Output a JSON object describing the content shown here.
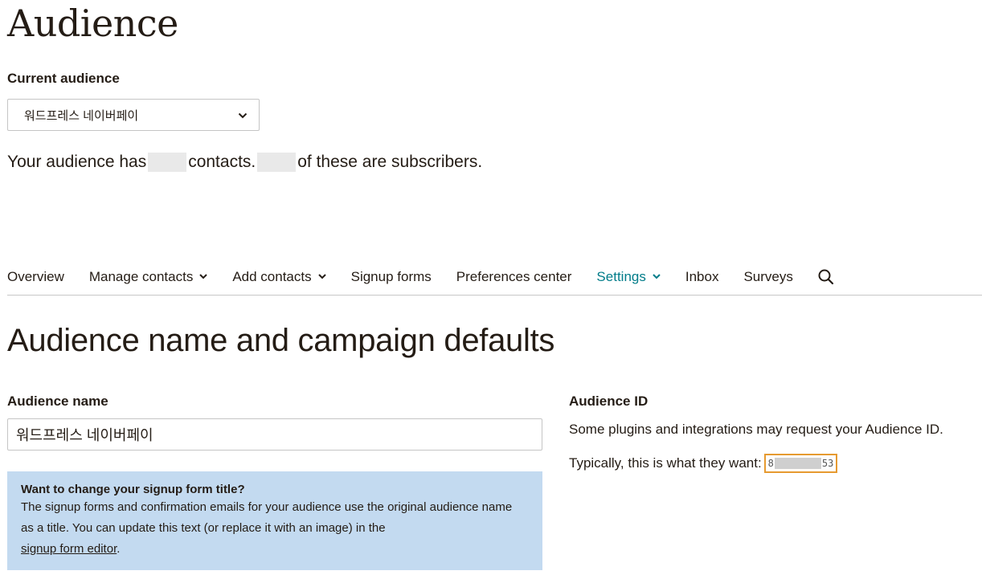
{
  "header": {
    "title": "Audience"
  },
  "current_audience": {
    "label": "Current audience",
    "selected": "워드프레스 네이버페이",
    "dropdown_icon": "chevron-down-icon"
  },
  "summary": {
    "prefix": "Your audience has",
    "middle": "contacts.",
    "suffix": "of these are subscribers."
  },
  "nav": {
    "items": [
      {
        "label": "Overview",
        "dropdown": false,
        "active": false
      },
      {
        "label": "Manage contacts",
        "dropdown": true,
        "active": false
      },
      {
        "label": "Add contacts",
        "dropdown": true,
        "active": false
      },
      {
        "label": "Signup forms",
        "dropdown": false,
        "active": false
      },
      {
        "label": "Preferences center",
        "dropdown": false,
        "active": false
      },
      {
        "label": "Settings",
        "dropdown": true,
        "active": true
      },
      {
        "label": "Inbox",
        "dropdown": false,
        "active": false
      },
      {
        "label": "Surveys",
        "dropdown": false,
        "active": false
      }
    ],
    "search_icon": "search-icon",
    "active_color": "#007c89"
  },
  "section": {
    "title": "Audience name and campaign defaults",
    "audience_name_label": "Audience name",
    "audience_name_value": "워드프레스 네이버페이",
    "info": {
      "title": "Want to change your signup form title?",
      "body": "The signup forms and confirmation emails for your audience use the original audience name as a title. You can update this text (or replace it with an image) in the",
      "link": "signup form editor",
      "end": "."
    },
    "audience_id_label": "Audience ID",
    "audience_id_desc": "Some plugins and integrations may request your Audience ID.",
    "audience_id_typical": "Typically, this is what they want:",
    "audience_id_start": "8",
    "audience_id_end": "53",
    "highlight_color": "#e69a30",
    "info_bg": "#c3daf0"
  }
}
